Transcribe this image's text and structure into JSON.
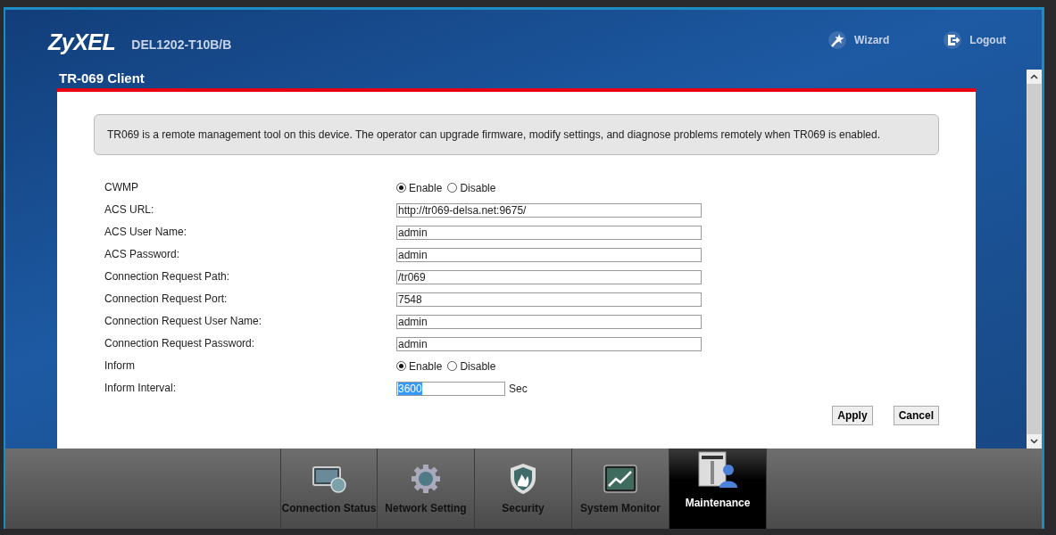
{
  "header": {
    "logo": "ZyXEL",
    "model": "DEL1202-T10B/B",
    "links": [
      {
        "kind": "wizard",
        "label": "Wizard"
      },
      {
        "kind": "logout",
        "label": "Logout"
      }
    ]
  },
  "page": {
    "title": "TR-069 Client",
    "info": "TR069 is a remote management tool on this device. The operator can upgrade firmware, modify settings, and diagnose problems remotely when TR069 is enabled.",
    "fields": [
      {
        "kind": "radio",
        "label": "CWMP",
        "options": [
          {
            "label": "Enable",
            "selected": true
          },
          {
            "label": "Disable",
            "selected": false
          }
        ]
      },
      {
        "kind": "text",
        "label": "ACS URL:",
        "value": "http://tr069-delsa.net:9675/"
      },
      {
        "kind": "text",
        "label": "ACS User Name:",
        "value": "admin"
      },
      {
        "kind": "text",
        "label": "ACS Password:",
        "value": "admin"
      },
      {
        "kind": "text",
        "label": "Connection Request Path:",
        "value": "/tr069"
      },
      {
        "kind": "text",
        "label": "Connection Request Port:",
        "value": "7548"
      },
      {
        "kind": "text",
        "label": "Connection Request User Name:",
        "value": "admin"
      },
      {
        "kind": "text",
        "label": "Connection Request Password:",
        "value": "admin"
      },
      {
        "kind": "radio",
        "label": "Inform",
        "options": [
          {
            "label": "Enable",
            "selected": true
          },
          {
            "label": "Disable",
            "selected": false
          }
        ]
      },
      {
        "kind": "short",
        "label": "Inform Interval:",
        "value": "3600",
        "text_selected": true,
        "unit": "Sec"
      }
    ],
    "buttons": [
      "Apply",
      "Cancel"
    ]
  },
  "nav": [
    {
      "label": "Connection Status",
      "selected": false
    },
    {
      "label": "Network Setting",
      "selected": false
    },
    {
      "label": "Security",
      "selected": false
    },
    {
      "label": "System Monitor",
      "selected": false
    },
    {
      "label": "Maintenance",
      "selected": true
    }
  ]
}
